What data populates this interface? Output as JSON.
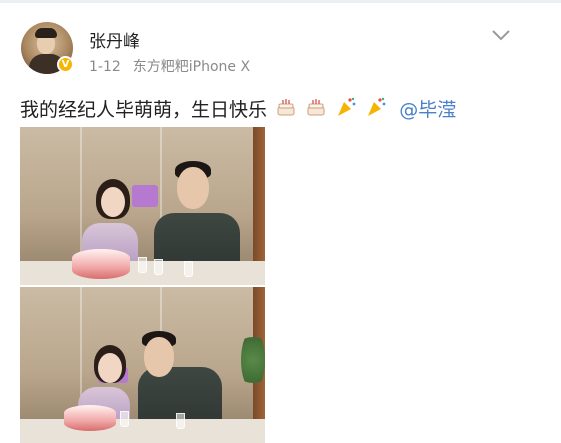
{
  "post": {
    "author": "张丹峰",
    "date": "1-12",
    "source": "东方粑粑iPhone X",
    "text": "我的经纪人毕萌萌，生日快乐",
    "mention": "@毕滢",
    "emoji": [
      "cake-emoji",
      "cake-emoji",
      "party-popper-emoji",
      "party-popper-emoji"
    ]
  },
  "header": {
    "verified_badge": "V"
  },
  "colors": {
    "link": "#4a7fc9",
    "meta": "#8a8a8a",
    "verified": "#f7b500"
  }
}
